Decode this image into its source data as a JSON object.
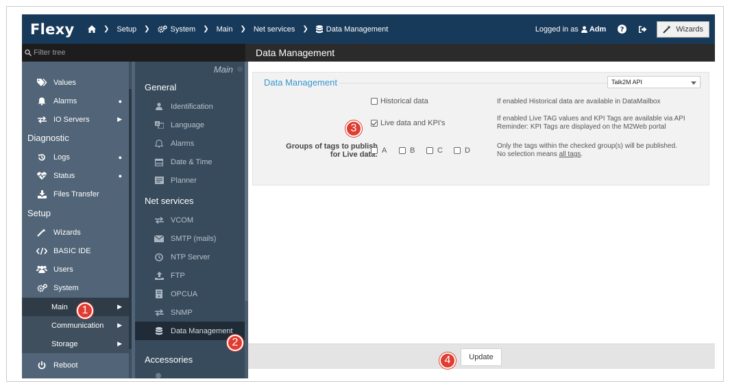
{
  "header": {
    "logo": "Flexy",
    "breadcrumbs": [
      "Setup",
      "System",
      "Main",
      "Net services",
      "Data Management"
    ],
    "logged_prefix": "Logged in as",
    "user": "Adm",
    "wizards_label": "Wizards"
  },
  "filter": {
    "placeholder": "Filter tree"
  },
  "page_title": "Data Management",
  "tree": {
    "items_top": [
      {
        "label": "Values",
        "icon": "tags-icon"
      },
      {
        "label": "Alarms",
        "icon": "bell-icon"
      },
      {
        "label": "IO Servers",
        "icon": "exchange-icon"
      }
    ],
    "sections": [
      "Diagnostic",
      "Setup"
    ],
    "diagnostic": [
      {
        "label": "Logs",
        "icon": "history-icon"
      },
      {
        "label": "Status",
        "icon": "heartbeat-icon"
      },
      {
        "label": "Files Transfer",
        "icon": "download-icon"
      }
    ],
    "setup": [
      {
        "label": "Wizards",
        "icon": "magic-wand-icon"
      },
      {
        "label": "BASIC IDE",
        "icon": "code-icon"
      },
      {
        "label": "Users",
        "icon": "users-icon"
      },
      {
        "label": "System",
        "icon": "cogs-icon"
      }
    ],
    "system_sub": [
      "Main",
      "Communication",
      "Storage"
    ],
    "reboot": "Reboot"
  },
  "middle": {
    "title": "Main",
    "sections": [
      "General",
      "Net services",
      "Accessories"
    ],
    "general": [
      "Identification",
      "Language",
      "Alarms",
      "Date & Time",
      "Planner"
    ],
    "net_services": [
      "VCOM",
      "SMTP (mails)",
      "NTP Server",
      "FTP",
      "OPCUA",
      "SNMP",
      "Data Management"
    ]
  },
  "panel": {
    "title": "Data Management",
    "api_select": "Talk2M API",
    "historical_label": "Historical data",
    "historical_hint": "If enabled Historical data are available in DataMailbox",
    "live_label": "Live data and KPI's",
    "live_hint_1": "If enabled Live TAG values and KPI Tags are available via API",
    "live_hint_2": "Reminder: KPI Tags are displayed on the M2Web portal",
    "groups_label_1": "Groups of tags to publish",
    "groups_label_2": "for Live data:",
    "groups": [
      "A",
      "B",
      "C",
      "D"
    ],
    "groups_hint_1": "Only the tags within the checked group(s) will be published.",
    "groups_hint_2": "No selection means",
    "groups_hint_link": "all tags",
    "groups_hint_end": "."
  },
  "footer": {
    "update_label": "Update"
  },
  "badges": [
    "1",
    "2",
    "3",
    "4"
  ],
  "colors": {
    "topbar": "#183a5a",
    "accent": "#3796cf",
    "badge": "#e03c31"
  }
}
